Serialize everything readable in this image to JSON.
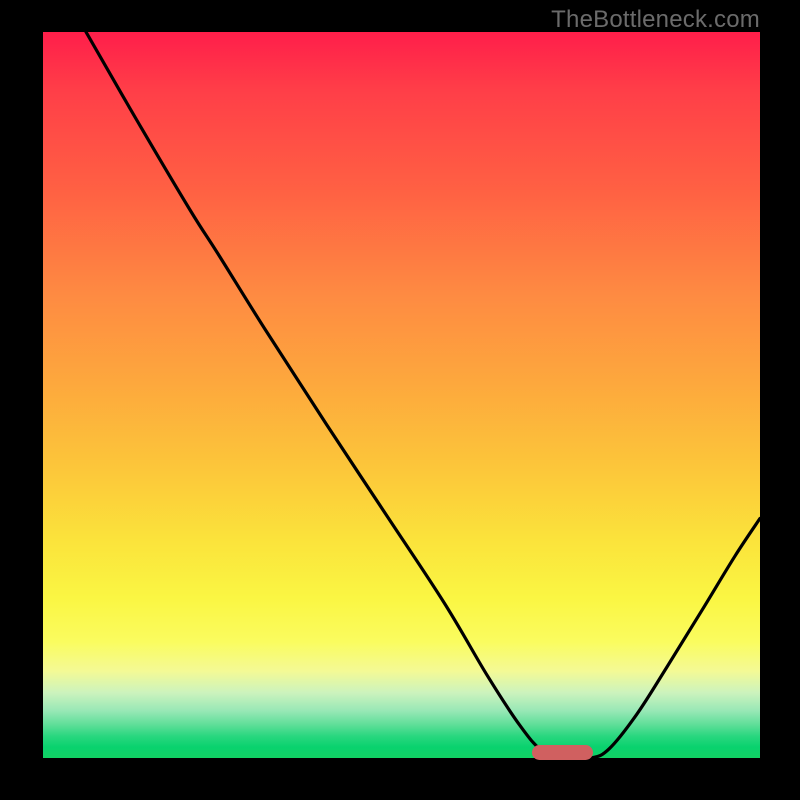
{
  "watermark": "TheBottleneck.com",
  "chart_data": {
    "type": "line",
    "title": "",
    "xlabel": "",
    "ylabel": "",
    "xlim": [
      0,
      1
    ],
    "ylim": [
      0,
      1
    ],
    "marker": {
      "x": 0.725,
      "width": 0.085,
      "y": 0.99
    },
    "series": [
      {
        "name": "curve",
        "points": [
          {
            "x": 0.06,
            "y": 1.0
          },
          {
            "x": 0.13,
            "y": 0.88
          },
          {
            "x": 0.205,
            "y": 0.755
          },
          {
            "x": 0.245,
            "y": 0.693
          },
          {
            "x": 0.31,
            "y": 0.59
          },
          {
            "x": 0.395,
            "y": 0.46
          },
          {
            "x": 0.48,
            "y": 0.333
          },
          {
            "x": 0.56,
            "y": 0.213
          },
          {
            "x": 0.62,
            "y": 0.113
          },
          {
            "x": 0.665,
            "y": 0.045
          },
          {
            "x": 0.696,
            "y": 0.01
          },
          {
            "x": 0.725,
            "y": 0.0
          },
          {
            "x": 0.764,
            "y": 0.0
          },
          {
            "x": 0.79,
            "y": 0.013
          },
          {
            "x": 0.828,
            "y": 0.06
          },
          {
            "x": 0.87,
            "y": 0.125
          },
          {
            "x": 0.92,
            "y": 0.205
          },
          {
            "x": 0.965,
            "y": 0.278
          },
          {
            "x": 1.0,
            "y": 0.33
          }
        ]
      }
    ],
    "gradient_stops": [
      {
        "t": 0.0,
        "color": "#FF1E4A"
      },
      {
        "t": 0.08,
        "color": "#FF3E48"
      },
      {
        "t": 0.22,
        "color": "#FF6143"
      },
      {
        "t": 0.36,
        "color": "#FE8A42"
      },
      {
        "t": 0.48,
        "color": "#FDA73D"
      },
      {
        "t": 0.6,
        "color": "#FCC63A"
      },
      {
        "t": 0.7,
        "color": "#FBE33B"
      },
      {
        "t": 0.78,
        "color": "#FAF643"
      },
      {
        "t": 0.84,
        "color": "#FAFC5F"
      },
      {
        "t": 0.88,
        "color": "#F4FA95"
      },
      {
        "t": 0.91,
        "color": "#CCF3BD"
      },
      {
        "t": 0.935,
        "color": "#98E8B6"
      },
      {
        "t": 0.955,
        "color": "#5CDE97"
      },
      {
        "t": 0.97,
        "color": "#29D77F"
      },
      {
        "t": 0.985,
        "color": "#09D26E"
      },
      {
        "t": 1.0,
        "color": "#12D264"
      }
    ]
  }
}
